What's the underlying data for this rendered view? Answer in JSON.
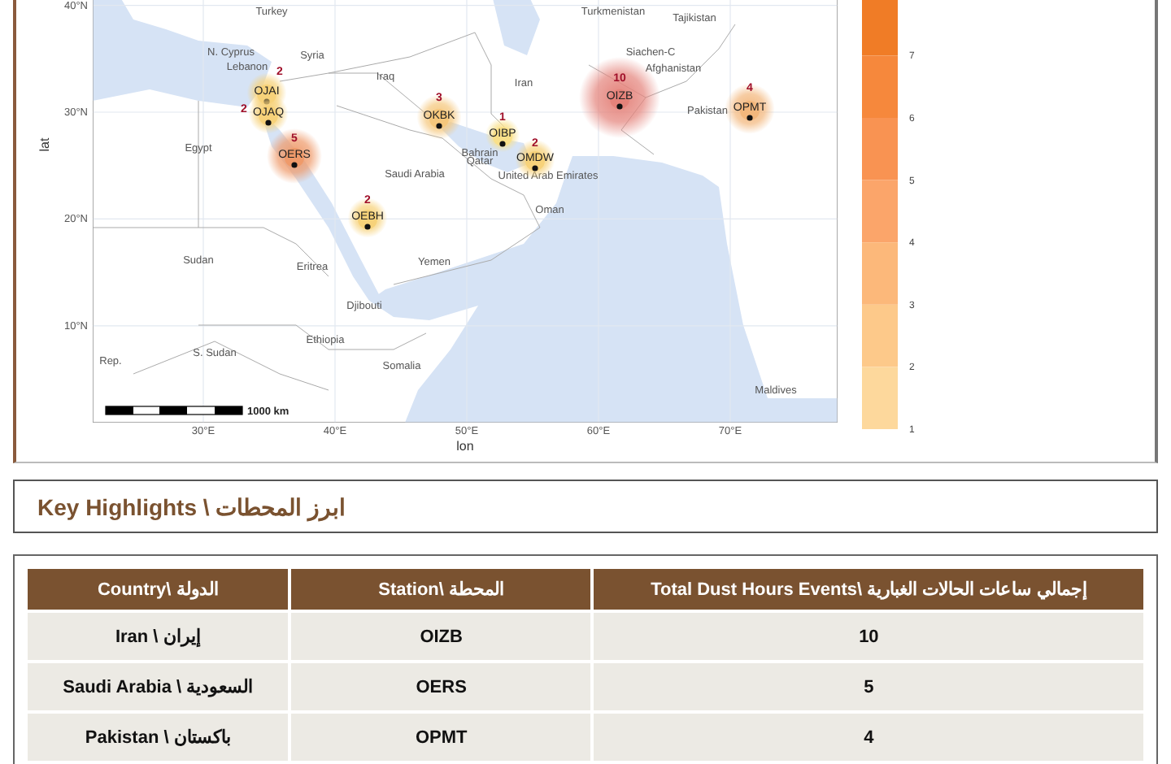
{
  "map": {
    "y_axis": {
      "title": "lat",
      "ticks": [
        "40°N",
        "30°N",
        "20°N",
        "10°N"
      ]
    },
    "x_axis": {
      "title": "lon",
      "ticks": [
        "30°E",
        "40°E",
        "50°E",
        "60°E",
        "70°E"
      ]
    },
    "countries": [
      "Turkey",
      "Turkmenistan",
      "Tajikistan",
      "N. Cyprus",
      "Syria",
      "Siachen-C",
      "Lebanon",
      "Afghanistan",
      "Iraq",
      "Iran",
      "Pakistan",
      "Egypt",
      "Bahrain",
      "Qatar",
      "Saudi Arabia",
      "United Arab Emirates",
      "Oman",
      "Sudan",
      "Yemen",
      "Eritrea",
      "Djibouti",
      "Ethiopia",
      "S. Sudan",
      "Rep.",
      "Somalia",
      "Maldives"
    ],
    "stations": [
      {
        "code": "OJAI",
        "count": "2",
        "color": "#f7d27a"
      },
      {
        "code": "OJAQ",
        "count": "2",
        "color": "#f7d27a"
      },
      {
        "code": "OERS",
        "count": "5",
        "color": "#ef9a6a"
      },
      {
        "code": "OEBH",
        "count": "2",
        "color": "#f7d27a"
      },
      {
        "code": "OKBK",
        "count": "3",
        "color": "#f5c77c"
      },
      {
        "code": "OIBP",
        "count": "1",
        "color": "#f9e08a"
      },
      {
        "code": "OMDW",
        "count": "2",
        "color": "#f7d27a"
      },
      {
        "code": "OIZB",
        "count": "10",
        "color": "#e4827a"
      },
      {
        "code": "OPMT",
        "count": "4",
        "color": "#f3b77c"
      }
    ],
    "scale_bar": "1000 km",
    "legend": [
      {
        "label": "7",
        "color": "#f07c26"
      },
      {
        "label": "6",
        "color": "#f6883c"
      },
      {
        "label": "5",
        "color": "#f99352"
      },
      {
        "label": "4",
        "color": "#fba56a"
      },
      {
        "label": "3",
        "color": "#fcb87a"
      },
      {
        "label": "2",
        "color": "#fdc98a"
      },
      {
        "label": "1",
        "color": "#fdd89c"
      }
    ]
  },
  "highlights": {
    "title": "Key Highlights \\ ابرز المحطات"
  },
  "table": {
    "columns": [
      "Country\\ الدولة",
      "Station\\ المحطة",
      "Total Dust Hours Events\\  إجمالي ساعات الحالات الغبارية"
    ],
    "rows": [
      [
        "Iran \\ إيران",
        "OIZB",
        "10"
      ],
      [
        "Saudi Arabia \\ السعودية",
        "OERS",
        "5"
      ],
      [
        "Pakistan \\ باكستان",
        "OPMT",
        "4"
      ]
    ]
  }
}
